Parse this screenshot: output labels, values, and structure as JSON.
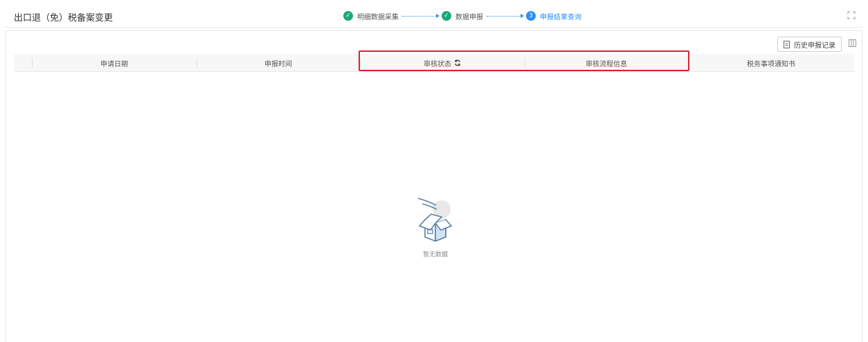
{
  "header": {
    "title": "出口退（免）税备案变更",
    "steps": [
      {
        "num": "✓",
        "label": "明细数据采集",
        "state": "done"
      },
      {
        "num": "✓",
        "label": "数据申报",
        "state": "done"
      },
      {
        "num": "3",
        "label": "申报结果查询",
        "state": "active"
      }
    ]
  },
  "toolbar": {
    "history_label": "历史申报记录"
  },
  "table": {
    "columns": [
      "申请日期",
      "申报时间",
      "审核状态",
      "审核流程信息",
      "税务事项通知书"
    ]
  },
  "empty": {
    "text": "暂无数据"
  },
  "colors": {
    "done": "#1ea87a",
    "active": "#2b8ef3",
    "highlight": "#d9232d"
  }
}
